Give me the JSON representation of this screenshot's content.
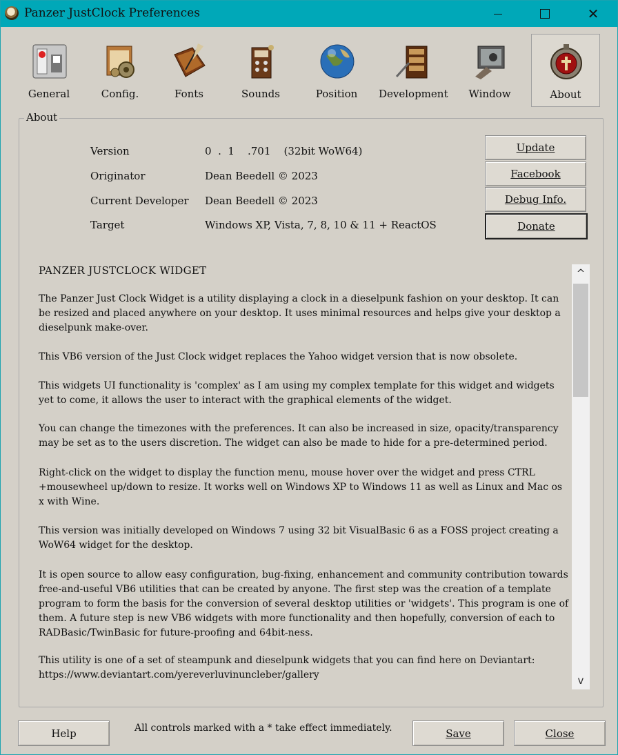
{
  "window": {
    "title": "Panzer JustClock Preferences"
  },
  "toolbar": {
    "items": [
      {
        "label": "General",
        "icon": "general-switch-icon"
      },
      {
        "label": "Config.",
        "icon": "config-gears-icon"
      },
      {
        "label": "Fonts",
        "icon": "fonts-book-quill-icon"
      },
      {
        "label": "Sounds",
        "icon": "sounds-radio-icon"
      },
      {
        "label": "Position",
        "icon": "position-globe-icon"
      },
      {
        "label": "Development",
        "icon": "development-desk-icon"
      },
      {
        "label": "Window",
        "icon": "window-monitor-icon"
      },
      {
        "label": "About",
        "icon": "about-emblem-icon"
      }
    ],
    "selected": "About"
  },
  "about": {
    "group_title": "About",
    "version_label": "Version",
    "version_value": "0  .  1    .701    (32bit WoW64)",
    "originator_label": "Originator",
    "originator_value": "Dean Beedell © 2023",
    "developer_label": "Current Developer",
    "developer_value": "Dean Beedell © 2023",
    "target_label": "Target",
    "target_value": "Windows XP, Vista, 7, 8, 10  & 11 + ReactOS"
  },
  "buttons": {
    "update": "Update",
    "facebook": "Facebook",
    "debug": "Debug Info.",
    "donate": "Donate",
    "help": "Help",
    "save": "Save",
    "close": "Close"
  },
  "text": {
    "heading": "PANZER JUSTCLOCK WIDGET",
    "p1": "The Panzer Just Clock Widget is a utility displaying a clock in a dieselpunk fashion on your desktop. It can be resized and placed anywhere on your desktop. It uses minimal resources and helps give your desktop a dieselpunk make-over.",
    "p2": "This VB6 version of the Just Clock widget replaces the Yahoo widget version that is now obsolete.",
    "p3": "This widgets UI functionality is 'complex' as I am using my complex template for this widget and widgets yet to come, it allows the user to interact with the graphical elements of the widget.",
    "p4": "You can change the timezones with the preferences. It can also be increased in size, opacity/transparency may be set as to the users discretion. The widget can also be made to hide for a pre-determined period.",
    "p5": "Right-click on the widget to display the function menu, mouse hover over the widget and press CTRL +mousewheel up/down to resize. It works well on Windows XP to Windows 11 as well as Linux and Mac os x with Wine.",
    "p6": "This version was initially developed on Windows 7 using 32 bit VisualBasic 6 as a FOSS project creating a WoW64 widget for the desktop.",
    "p7": "It is open source to allow easy configuration, bug-fixing, enhancement and community contribution towards free-and-useful VB6 utilities that can be created by anyone. The first step was the creation of a template program to form the basis for the conversion of several desktop utilities or 'widgets'. This program is one of them. A future step is new VB6 widgets with more functionality and then hopefully, conversion of each to RADBasic/TwinBasic for future-proofing and 64bit-ness.",
    "p8": "This utility is one of a set of steampunk and dieselpunk widgets that you can find here on Deviantart: https://www.deviantart.com/yereverluvinuncleber/gallery"
  },
  "status": "All controls marked with a * take effect immediately.",
  "colors": {
    "titlebar": "#00a8b8",
    "background": "#d4d0c8"
  }
}
